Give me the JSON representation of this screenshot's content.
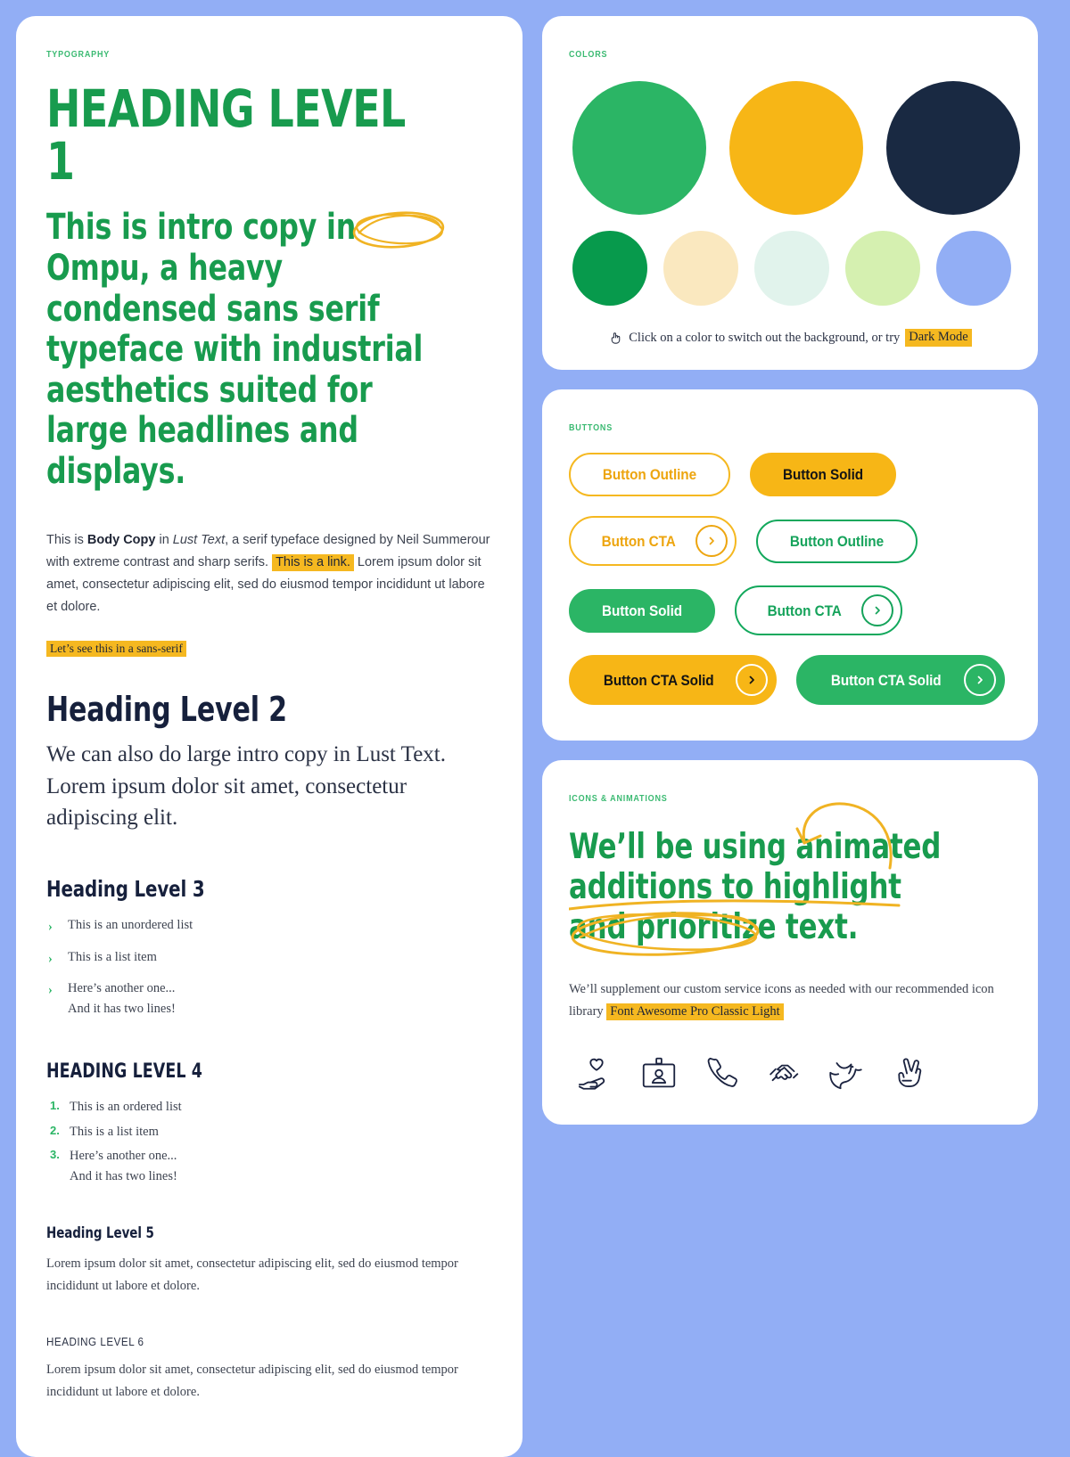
{
  "theme": {
    "page_background": "#92aef5",
    "card_background": "#ffffff",
    "primary_green": "#2bb565",
    "deep_green": "#189b4e",
    "accent_yellow": "#f7b616",
    "navy": "#16203c",
    "body_text": "#3d4350"
  },
  "typography": {
    "eyebrow": "TYPOGRAPHY",
    "h1": "Heading Level 1",
    "intro": {
      "before": "This is intro copy in ",
      "circled": "Ompu",
      "after": ", a heavy condensed sans serif typeface with industrial aesthetics suited for large headlines and displays."
    },
    "body_copy": {
      "p1_a": "This is ",
      "p1_bold": "Body Copy",
      "p1_b": " in ",
      "p1_italic": "Lust Text",
      "p1_c": ", a serif typeface designed by Neil Summerour with extreme contrast and sharp serifs. ",
      "p1_link": "This is a link.",
      "p1_d": " Lorem ipsum dolor sit amet, consectetur adipiscing elit, sed do eiusmod tempor incididunt ut labore et dolore."
    },
    "sans_note": "Let’s see this in a sans-serif",
    "h2": "Heading Level 2",
    "large_intro": "We can also do large intro copy in Lust Text. Lorem ipsum dolor sit amet, consectetur adipiscing elit.",
    "h3": "Heading Level 3",
    "unordered_list": [
      {
        "text": "This is an unordered list",
        "second_line": ""
      },
      {
        "text": "This is a list item",
        "second_line": ""
      },
      {
        "text": "Here’s another one...",
        "second_line": "And it has two lines!"
      }
    ],
    "h4": "HEADING LEVEL 4",
    "ordered_list": [
      {
        "marker": "1.",
        "text": "This is an ordered list",
        "second_line": ""
      },
      {
        "marker": "2.",
        "text": "This is a list item",
        "second_line": ""
      },
      {
        "marker": "3.",
        "text": "Here’s another one...",
        "second_line": "And it has two lines!"
      }
    ],
    "h5": "Heading Level 5",
    "h5_para": "Lorem ipsum dolor sit amet, consectetur adipiscing elit, sed do eiusmod tempor incididunt ut labore et dolore.",
    "h6": "HEADING LEVEL 6",
    "h6_para": "Lorem ipsum dolor sit amet, consectetur adipiscing elit, sed do eiusmod tempor incididunt ut labore et dolore."
  },
  "colors": {
    "eyebrow": "COLORS",
    "primary_swatches": [
      {
        "name": "green",
        "hex": "#2bb565"
      },
      {
        "name": "yellow",
        "hex": "#f7b616"
      },
      {
        "name": "navy",
        "hex": "#192942"
      }
    ],
    "secondary_swatches": [
      {
        "name": "dark-green",
        "hex": "#079a4c"
      },
      {
        "name": "cream",
        "hex": "#fae8bf"
      },
      {
        "name": "mint",
        "hex": "#e1f3ec"
      },
      {
        "name": "lime",
        "hex": "#d5f0b0"
      },
      {
        "name": "periwinkle",
        "hex": "#92aef5"
      }
    ],
    "note_icon": "hand-pointer-icon",
    "note_before": "Click on a color to switch out the background, or try ",
    "note_link": "Dark Mode"
  },
  "buttons": {
    "eyebrow": "BUTTONS",
    "rows": [
      [
        {
          "label": "Button Outline",
          "style": "btn-plain btn-outline-y",
          "cta": false,
          "name": "button-outline-yellow"
        },
        {
          "label": "Button Solid",
          "style": "btn-plain btn-solid-y",
          "cta": false,
          "name": "button-solid-yellow"
        }
      ],
      [
        {
          "label": "Button CTA",
          "style": "btn-cta btn-cta-y",
          "cta": true,
          "name": "button-cta-yellow"
        },
        {
          "label": "Button Outline",
          "style": "btn-plain btn-outline-g",
          "cta": false,
          "name": "button-outline-green"
        }
      ],
      [
        {
          "label": "Button Solid",
          "style": "btn-plain btn-solid-g",
          "cta": false,
          "name": "button-solid-green"
        },
        {
          "label": "Button CTA",
          "style": "btn-cta btn-cta-g",
          "cta": true,
          "name": "button-cta-green"
        }
      ],
      [
        {
          "label": "Button CTA Solid",
          "style": "btn-cta btn-cta-sy",
          "cta": true,
          "name": "button-cta-solid-yellow"
        },
        {
          "label": "Button CTA Solid",
          "style": "btn-cta btn-cta-sg",
          "cta": true,
          "name": "button-cta-solid-green"
        }
      ]
    ]
  },
  "icons": {
    "eyebrow": "ICONS & ANIMATIONS",
    "headline": "We’ll be using animated additions to highlight and prioritize text.",
    "para_before": "We’ll supplement our custom service icons as needed with our recommended icon library ",
    "para_highlight": "Font Awesome Pro Classic Light",
    "icon_set": [
      "hand-holding-heart-icon",
      "id-card-icon",
      "phone-icon",
      "handshake-icon",
      "dove-icon",
      "hand-peace-icon"
    ]
  }
}
